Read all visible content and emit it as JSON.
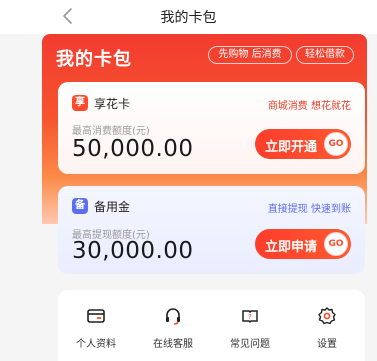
{
  "nav": {
    "title": "我的卡包"
  },
  "hero": {
    "title": "我的卡包",
    "tags": [
      "先购物 后消费",
      "轻松借款"
    ]
  },
  "cards": [
    {
      "icon_glyph": "享",
      "icon_color": "#ff4a2e",
      "name": "享花卡",
      "tag": "商城消费 想花就花",
      "tag_color": "#e8402a",
      "sub": "最高消费额度(元)",
      "amount": "50,000.00",
      "button": "立即开通",
      "go": "GO"
    },
    {
      "icon_glyph": "备",
      "icon_color": "#5a6ff0",
      "name": "备用金",
      "tag": "直接提现 快速到账",
      "tag_color": "#5a6ff0",
      "sub": "最高提现额度(元)",
      "amount": "30,000.00",
      "button": "立即申请",
      "go": "GO"
    }
  ],
  "menu": [
    {
      "label": "个人资料",
      "icon": "id-card-icon"
    },
    {
      "label": "在线客服",
      "icon": "headset-icon"
    },
    {
      "label": "常见问题",
      "icon": "book-question-icon"
    },
    {
      "label": "设置",
      "icon": "gear-icon"
    }
  ],
  "colors": {
    "accent": "#f23b30",
    "accent2": "#fb8a48"
  }
}
